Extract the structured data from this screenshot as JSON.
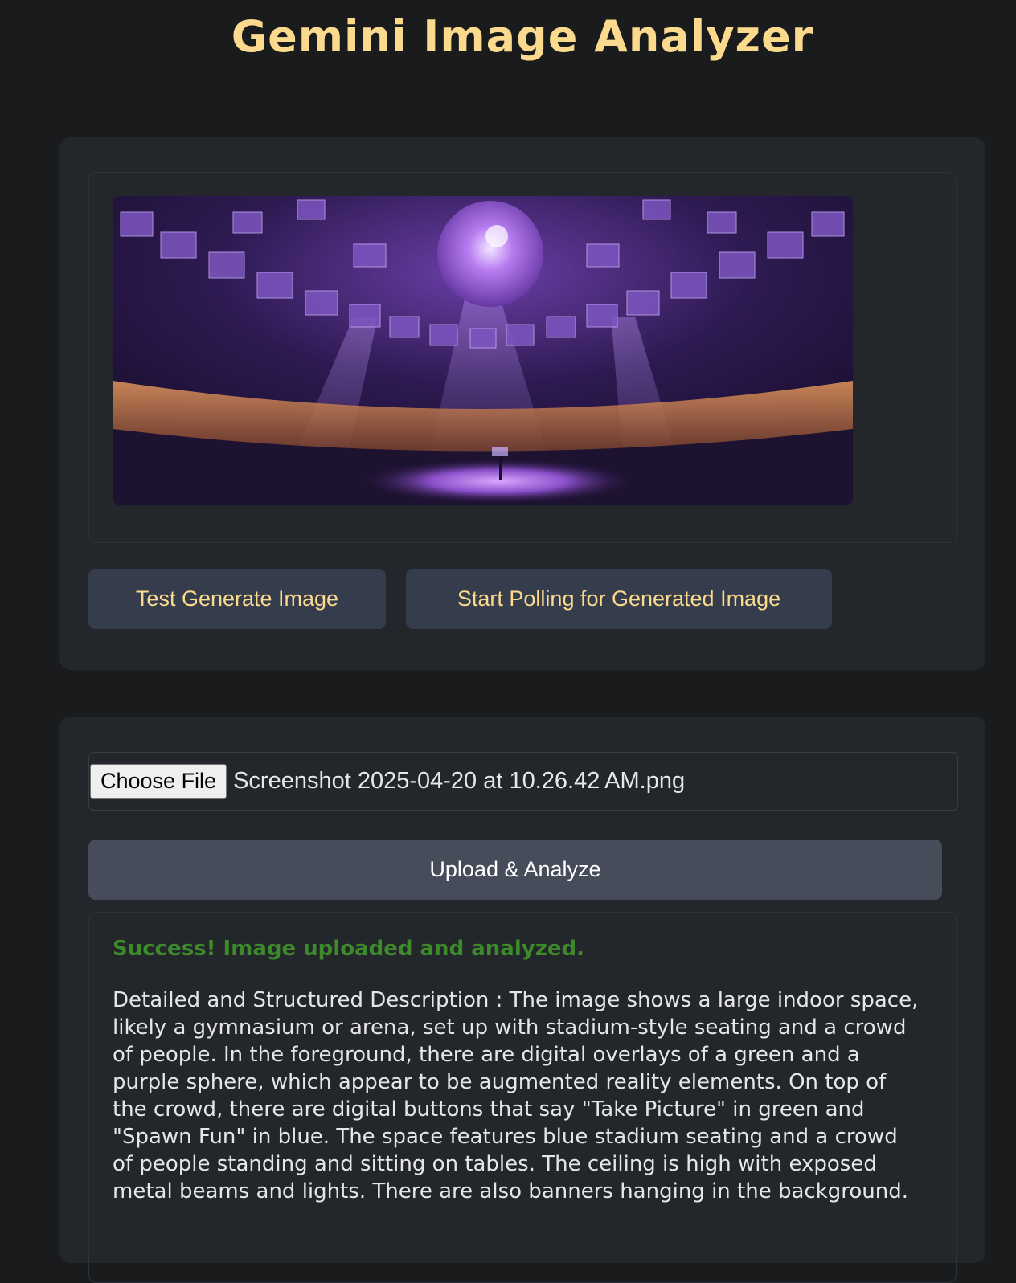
{
  "page": {
    "title": "Gemini Image Analyzer"
  },
  "generator": {
    "test_button": "Test Generate Image",
    "poll_button": "Start Polling for Generated Image"
  },
  "upload": {
    "choose_file_label": "Choose File",
    "file_name": "Screenshot 2025-04-20 at 10.26.42 AM.png",
    "upload_button": "Upload & Analyze"
  },
  "result": {
    "status": "Success! Image uploaded and analyzed.",
    "description": "Detailed and Structured Description : The image shows a large indoor space, likely a gymnasium or arena, set up with stadium-style seating and a crowd of people. In the foreground, there are digital overlays of a green and a purple sphere, which appear to be augmented reality elements. On top of the crowd, there are digital buttons that say \"Take Picture\" in green and \"Spawn Fun\" in blue. The space features blue stadium seating and a crowd of people standing and sitting on tables. The ceiling is high with exposed metal beams and lights. There are also banners hanging in the background."
  },
  "colors": {
    "background": "#1a1b1d",
    "card": "#23262b",
    "accent_gold": "#fbd98d",
    "button": "#353c4c",
    "upload_button": "#464c5a",
    "success_green": "#3c8a2a"
  }
}
